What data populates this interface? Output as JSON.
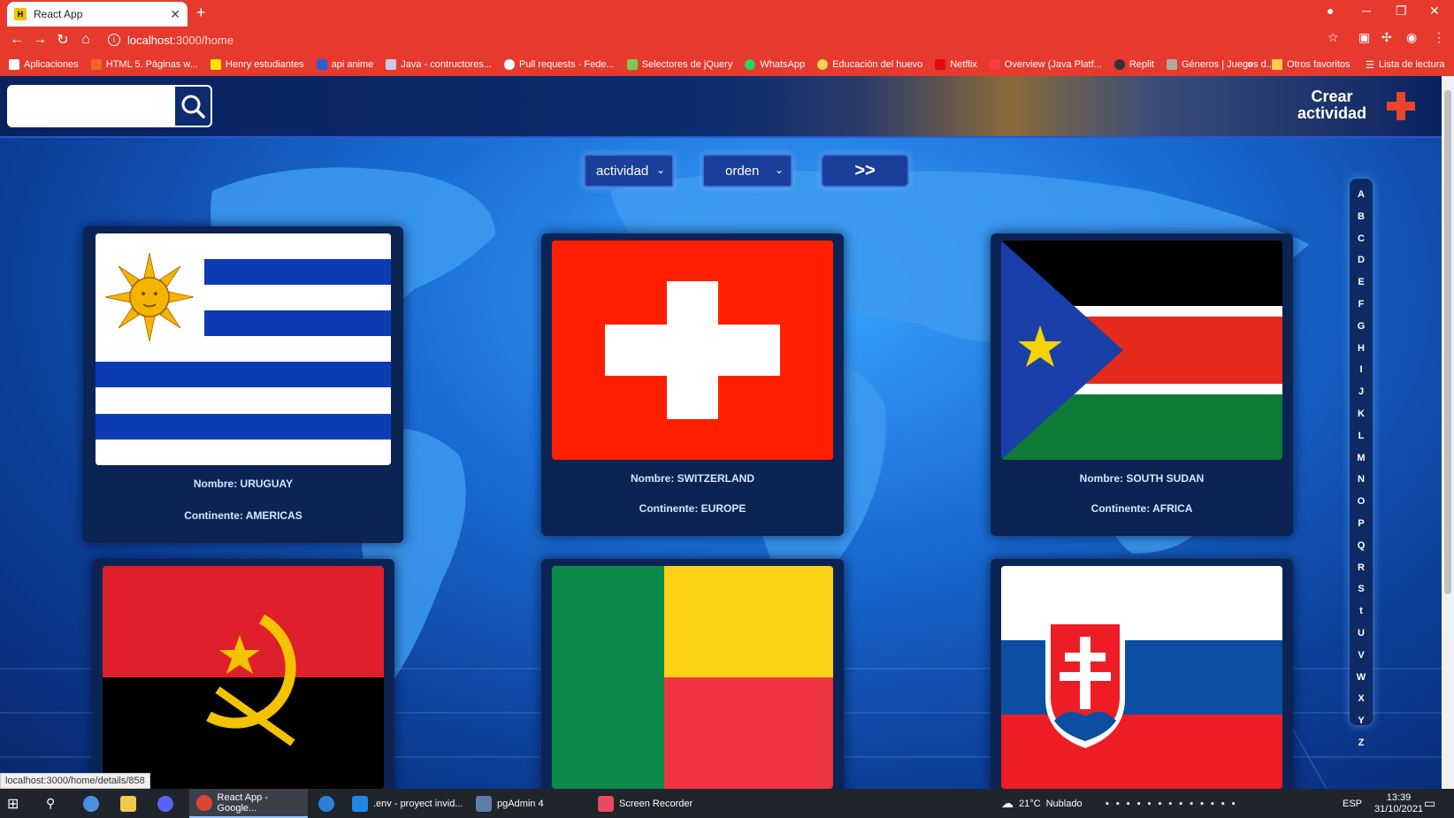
{
  "browser": {
    "tab_title": "React App",
    "url_host": "localhost",
    "url_path": ":3000/home",
    "bookmarks": [
      "Aplicaciones",
      "HTML 5. Páginas w...",
      "Henry estudiantes",
      "api anime",
      "Java - contructores...",
      "Pull requests · Fede...",
      "Selectores de jQuery",
      "WhatsApp",
      "Educación del huevo",
      "Netflix",
      "Overview (Java Platf...",
      "Replit",
      "Géneros | Juegos d..."
    ],
    "bookmarks_more": "»",
    "other_favorites": "Otros favoritos",
    "reading_list": "Lista de lectura",
    "status_url": "localhost:3000/home/details/858"
  },
  "header": {
    "search_placeholder": "",
    "create_label_line1": "Crear",
    "create_label_line2": "actividad"
  },
  "filters": {
    "activity_select": "actividad",
    "order_select": "orden",
    "next_label": ">>"
  },
  "alphabet": [
    "A",
    "B",
    "C",
    "D",
    "E",
    "F",
    "G",
    "H",
    "I",
    "J",
    "K",
    "L",
    "M",
    "N",
    "O",
    "P",
    "Q",
    "R",
    "S",
    "t",
    "U",
    "V",
    "W",
    "X",
    "Y",
    "Z"
  ],
  "countries": [
    {
      "name_line": "Nombre: URUGUAY",
      "continent_line": "Continente: AMERICAS"
    },
    {
      "name_line": "Nombre: SWITZERLAND",
      "continent_line": "Continente: EUROPE"
    },
    {
      "name_line": "Nombre: SOUTH SUDAN",
      "continent_line": "Continente: AFRICA"
    },
    {
      "name_line": "",
      "continent_line": ""
    },
    {
      "name_line": "",
      "continent_line": ""
    },
    {
      "name_line": "",
      "continent_line": ""
    }
  ],
  "taskbar": {
    "items": [
      "React App - Google...",
      ".env - proyect invid...",
      "pgAdmin 4",
      "Screen Recorder"
    ],
    "weather_temp": "21°C",
    "weather_text": "Nublado",
    "lang": "ESP",
    "time": "13:39",
    "date": "31/10/2021"
  }
}
